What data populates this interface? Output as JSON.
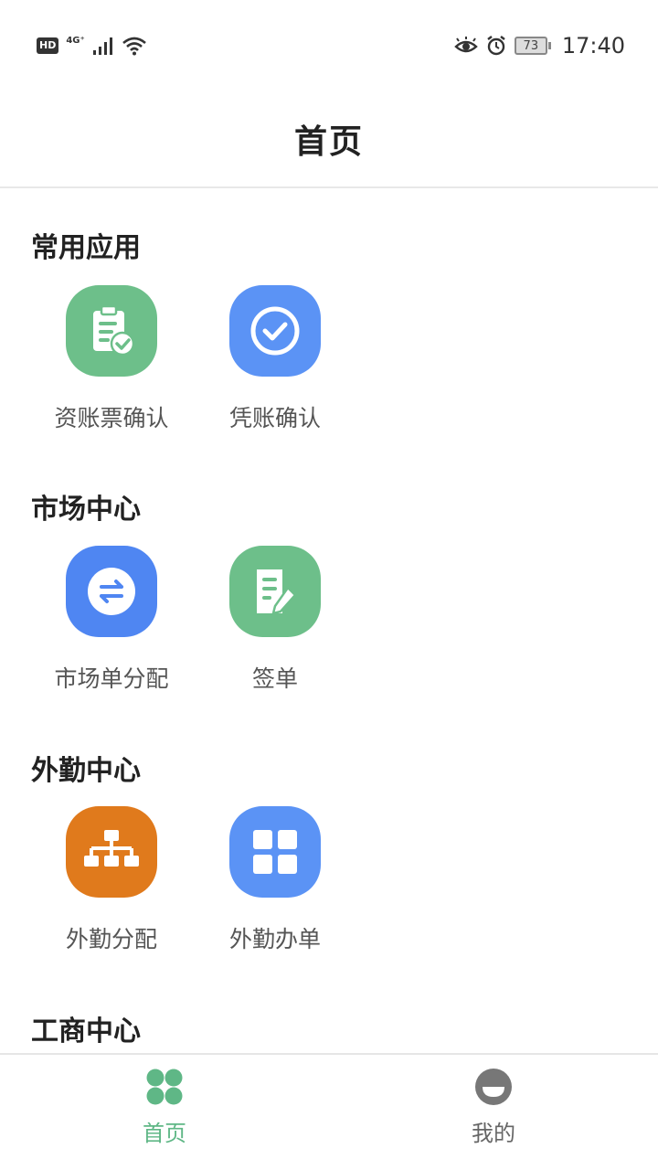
{
  "status_bar": {
    "hd": "HD",
    "network": "4G⁺",
    "battery": "73",
    "time": "17:40"
  },
  "header": {
    "title": "首页"
  },
  "colors": {
    "green": "#6dbf8a",
    "blue": "#5b93f5",
    "blue_dark": "#4f86f2",
    "orange": "#e07a1c",
    "nav_active": "#5fb786",
    "nav_inactive": "#666666"
  },
  "sections": [
    {
      "title": "常用应用",
      "apps": [
        {
          "label": "资账票确认",
          "icon": "clipboard-check-icon",
          "color": "#6dbf8a"
        },
        {
          "label": "凭账确认",
          "icon": "check-circle-icon",
          "color": "#5b93f5"
        }
      ]
    },
    {
      "title": "市场中心",
      "apps": [
        {
          "label": "市场单分配",
          "icon": "swap-arrows-icon",
          "color": "#4f86f2"
        },
        {
          "label": "签单",
          "icon": "document-edit-icon",
          "color": "#6dbf8a"
        }
      ]
    },
    {
      "title": "外勤中心",
      "apps": [
        {
          "label": "外勤分配",
          "icon": "org-chart-icon",
          "color": "#e07a1c"
        },
        {
          "label": "外勤办单",
          "icon": "grid-icon",
          "color": "#5b93f5"
        }
      ]
    },
    {
      "title": "工商中心",
      "apps": []
    }
  ],
  "nav": {
    "home_label": "首页",
    "mine_label": "我的"
  }
}
